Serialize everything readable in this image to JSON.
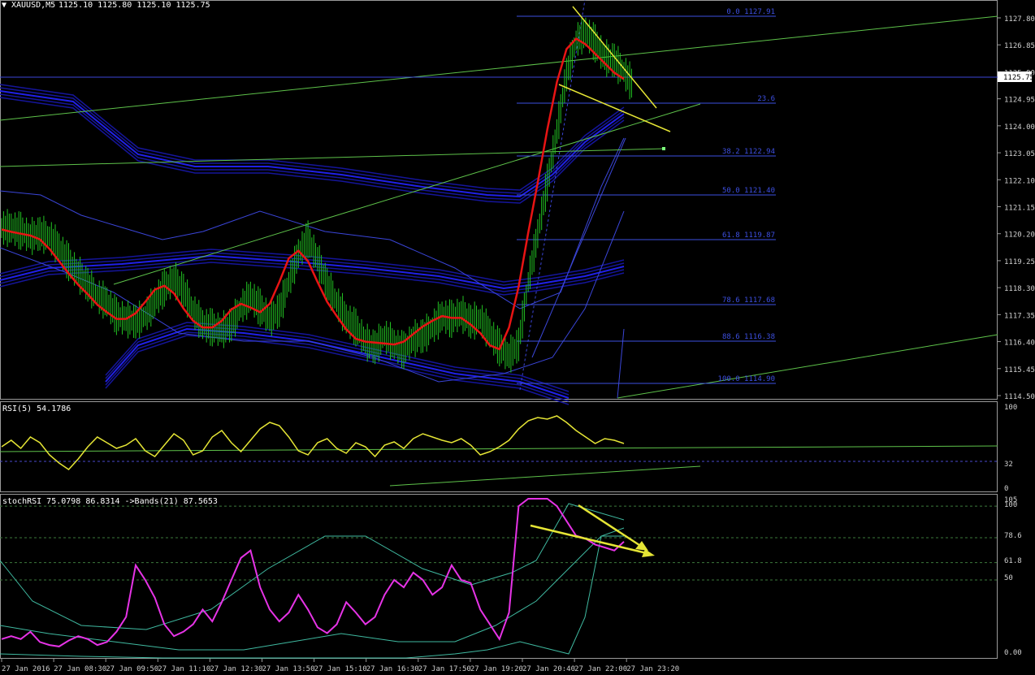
{
  "header": {
    "symbol": "XAUUSD,M5",
    "ohlc": "1125.10 1125.80 1125.10 1125.75"
  },
  "chart_data": [
    {
      "type": "candlestick",
      "title": "XAUUSD,M5",
      "ylim": [
        1114.5,
        1128.0
      ],
      "y_ticks": [
        "1127.80",
        "1126.85",
        "1125.90",
        "1124.95",
        "1124.00",
        "1123.05",
        "1122.10",
        "1121.15",
        "1120.20",
        "1119.25",
        "1118.30",
        "1117.35",
        "1116.40",
        "1115.45",
        "1114.50"
      ],
      "current_price": "1125.75",
      "price": [
        1120.4,
        1120.3,
        1120.1,
        1120.2,
        1120.1,
        1119.7,
        1119.2,
        1118.8,
        1118.4,
        1118.0,
        1117.8,
        1117.3,
        1117.2,
        1117.1,
        1117.3,
        1117.8,
        1118.3,
        1118.6,
        1118.2,
        1117.5,
        1117.0,
        1116.9,
        1116.8,
        1117.0,
        1117.6,
        1118.0,
        1117.6,
        1117.2,
        1117.5,
        1118.5,
        1119.5,
        1120.0,
        1119.3,
        1118.4,
        1117.8,
        1117.2,
        1116.9,
        1116.4,
        1116.2,
        1116.6,
        1116.3,
        1116.1,
        1116.5,
        1116.6,
        1116.9,
        1117.3,
        1117.2,
        1117.4,
        1117.1,
        1117.2,
        1116.7,
        1116.2,
        1115.9,
        1116.3,
        1118.5,
        1120.2,
        1122.0,
        1123.8,
        1125.8,
        1127.0,
        1127.3,
        1126.9,
        1126.4,
        1126.3,
        1125.9,
        1125.4
      ],
      "fibonacci": [
        {
          "level": "0.0",
          "price": "1127.91"
        },
        {
          "level": "23.6",
          "price": ""
        },
        {
          "level": "38.2",
          "price": "1122.94"
        },
        {
          "level": "50.0",
          "price": "1121.40"
        },
        {
          "level": "61.8",
          "price": "1119.87"
        },
        {
          "level": "78.6",
          "price": "1117.68"
        },
        {
          "level": "88.6",
          "price": "1116.38"
        },
        {
          "level": "100.0",
          "price": "1114.90"
        }
      ],
      "colors": {
        "bars": "#22c322",
        "ma": "#e81414",
        "envelope": "#1a1acd",
        "bands": "#3a45d8",
        "fib": "#3d4fe0",
        "trend": "#5ec24a",
        "pattern": "#e5e535"
      }
    },
    {
      "type": "line",
      "title": "RSI(5) 54.1786",
      "ylim": [
        0,
        100
      ],
      "y_ticks": [
        "100",
        "32",
        "0"
      ],
      "levels": [
        32
      ],
      "values": [
        50,
        58,
        48,
        62,
        55,
        40,
        30,
        22,
        35,
        50,
        62,
        55,
        48,
        52,
        60,
        45,
        38,
        52,
        66,
        58,
        40,
        45,
        62,
        70,
        55,
        44,
        58,
        72,
        80,
        76,
        62,
        45,
        40,
        55,
        60,
        48,
        42,
        55,
        50,
        38,
        52,
        56,
        48,
        60,
        66,
        62,
        58,
        55,
        60,
        52,
        40,
        44,
        50,
        58,
        72,
        82,
        86,
        84,
        88,
        80,
        70,
        62,
        54,
        60,
        58,
        54
      ],
      "color": "#e5e535"
    },
    {
      "type": "line",
      "title": "stochRSI 75.0798 86.8314 ->Bands(21) 87.5653",
      "ylim": [
        0,
        100
      ],
      "y_ticks": [
        "105",
        "100",
        "78.6",
        "61.8",
        "50",
        "0.00"
      ],
      "levels": [
        100,
        78.6,
        61.8,
        50
      ],
      "values": [
        10,
        12,
        10,
        15,
        8,
        6,
        5,
        9,
        12,
        10,
        6,
        8,
        15,
        25,
        60,
        50,
        38,
        20,
        12,
        15,
        20,
        30,
        22,
        35,
        50,
        65,
        70,
        45,
        30,
        22,
        28,
        40,
        30,
        18,
        14,
        20,
        35,
        28,
        20,
        25,
        40,
        50,
        45,
        55,
        50,
        40,
        45,
        60,
        50,
        48,
        30,
        20,
        10,
        28,
        100,
        105,
        105,
        105,
        100,
        90,
        80,
        78,
        74,
        72,
        70,
        76
      ],
      "color": "#e633e6"
    }
  ],
  "x_axis": {
    "labels": [
      "27 Jan 2016",
      "27 Jan 08:30",
      "27 Jan 09:50",
      "27 Jan 11:10",
      "27 Jan 12:30",
      "27 Jan 13:50",
      "27 Jan 15:10",
      "27 Jan 16:30",
      "27 Jan 17:50",
      "27 Jan 19:20",
      "27 Jan 20:40",
      "27 Jan 22:00",
      "27 Jan 23:20"
    ]
  }
}
